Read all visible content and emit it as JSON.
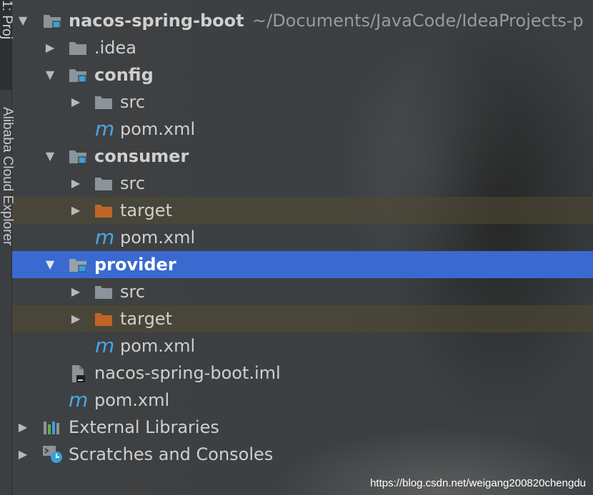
{
  "sidebar": {
    "top_tab_label": "1: Proj",
    "tool_window_label": "Alibaba Cloud Explorer"
  },
  "tree": {
    "root": {
      "name": "nacos-spring-boot",
      "path": "~/Documents/JavaCode/IdeaProjects-p"
    },
    "idea": ".idea",
    "config": {
      "name": "config",
      "src": "src",
      "pom": "pom.xml"
    },
    "consumer": {
      "name": "consumer",
      "src": "src",
      "target": "target",
      "pom": "pom.xml"
    },
    "provider": {
      "name": "provider",
      "src": "src",
      "target": "target",
      "pom": "pom.xml"
    },
    "iml": "nacos-spring-boot.iml",
    "root_pom": "pom.xml",
    "external_libraries": "External Libraries",
    "scratches": "Scratches and Consoles",
    "maven_glyph": "m"
  },
  "watermark": "https://blog.csdn.net/weigang200820chengdu",
  "colors": {
    "selection": "#3a6ad0",
    "excluded_row": "#524a32",
    "folder_gray": "#8c9399",
    "folder_excluded": "#c0652a",
    "module_marker": "#3a9fd8",
    "maven": "#4aa6e6"
  }
}
